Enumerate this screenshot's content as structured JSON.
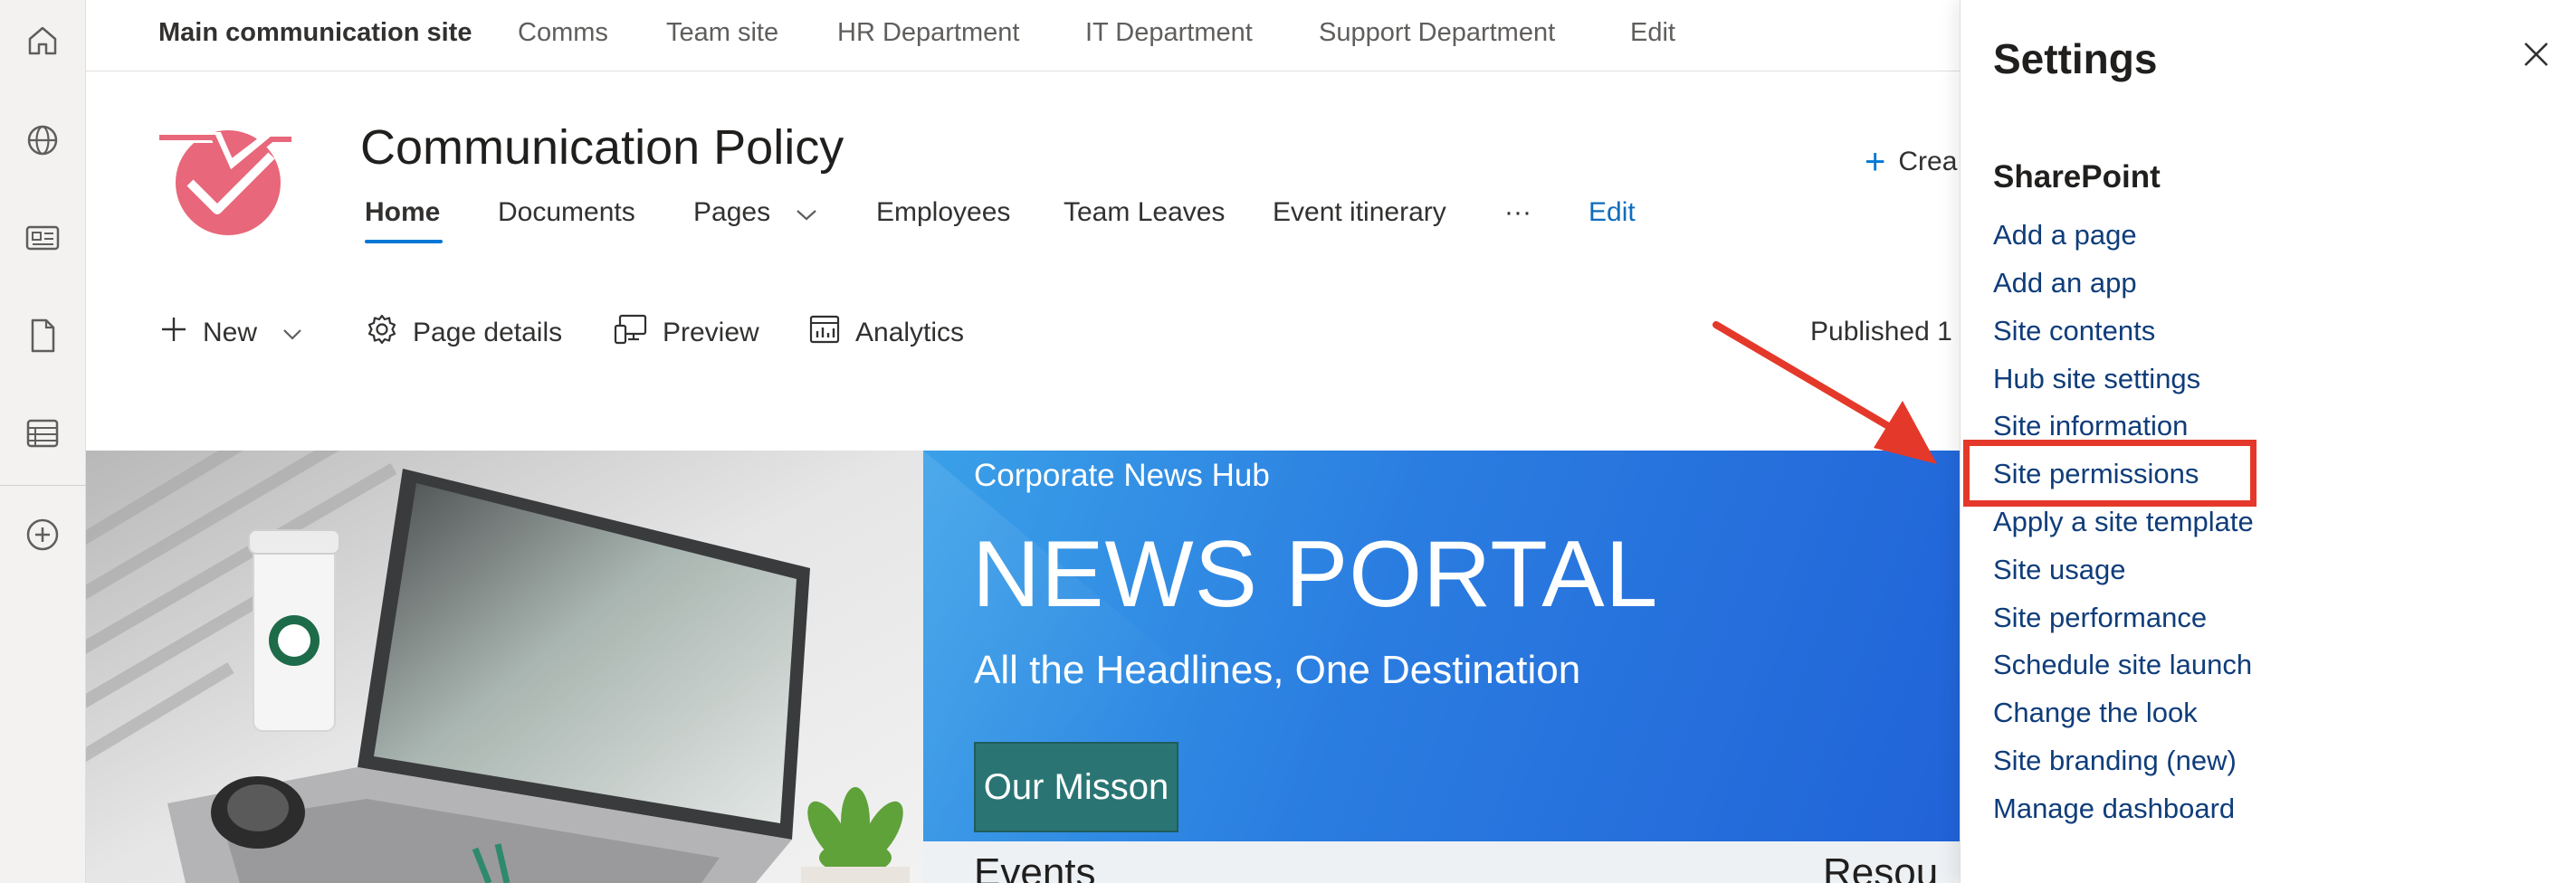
{
  "hub_nav": {
    "home": "Main communication site",
    "items": [
      "Comms",
      "Team site",
      "HR Department",
      "IT Department",
      "Support Department",
      "Edit"
    ]
  },
  "site": {
    "title": "Communication Policy",
    "nav": [
      "Home",
      "Documents",
      "Pages",
      "Employees",
      "Team Leaves",
      "Event itinerary",
      "···",
      "Edit"
    ],
    "create_label": "Crea"
  },
  "command_bar": {
    "new": "New",
    "page_details": "Page details",
    "preview": "Preview",
    "analytics": "Analytics",
    "published": "Published 1"
  },
  "hero": {
    "eyebrow": "Corporate News Hub",
    "title": "NEWS PORTAL",
    "subtitle": "All the Headlines, One Destination",
    "cta": "Our Misson"
  },
  "sections": {
    "events": "Events",
    "resources": "Resou"
  },
  "settings_panel": {
    "title": "Settings",
    "section": "SharePoint",
    "links": [
      "Add a page",
      "Add an app",
      "Site contents",
      "Hub site settings",
      "Site information",
      "Site permissions",
      "Apply a site template",
      "Site usage",
      "Site performance",
      "Schedule site launch",
      "Change the look",
      "Site branding (new)",
      "Manage dashboard"
    ],
    "highlighted": "Site permissions"
  },
  "colors": {
    "accent": "#0078d4",
    "logo": "#e8677a",
    "annotation": "#e4392a",
    "hero_blue": "#2a7ce0",
    "cta": "#2a7574",
    "link": "#0f3d7a"
  },
  "icons": {
    "appbar": [
      "home-icon",
      "globe-icon",
      "news-icon",
      "document-icon",
      "list-icon",
      "add-circle-icon"
    ],
    "command_bar": [
      "plus-icon",
      "gear-icon",
      "preview-icon",
      "analytics-icon"
    ]
  }
}
